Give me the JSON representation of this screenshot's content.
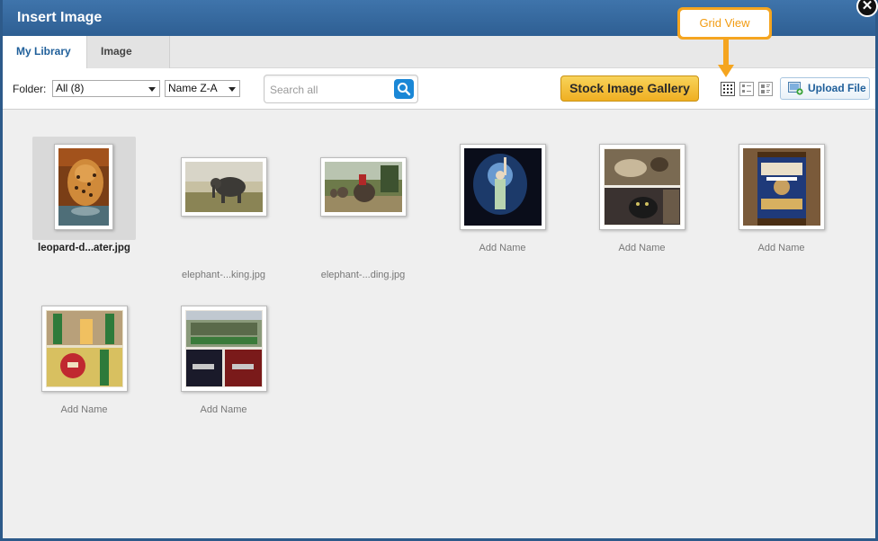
{
  "dialog": {
    "title": "Insert Image",
    "close_symbol": "✕"
  },
  "tabs": [
    {
      "label": "My Library",
      "active": true
    },
    {
      "label": "Image URL",
      "active": false
    }
  ],
  "toolbar": {
    "folder_label": "Folder:",
    "folder_value": "All (8)",
    "sort_value": "Name Z-A",
    "search_placeholder": "Search all",
    "stock_button": "Stock Image Gallery",
    "upload_button": "Upload File",
    "view_modes": [
      "grid-view-icon",
      "list-view-icon",
      "detail-view-icon"
    ],
    "accent_color": "#f0b12a"
  },
  "callout": {
    "text": "Grid View",
    "color": "#f5a51f"
  },
  "images": [
    {
      "name": "leopard-d...ater.jpg",
      "selected": true,
      "orientation": "portrait"
    },
    {
      "name": "elephant-...king.jpg",
      "selected": false,
      "orientation": "landscape"
    },
    {
      "name": "elephant-...ding.jpg",
      "selected": false,
      "orientation": "landscape"
    },
    {
      "name": "Add Name",
      "selected": false,
      "orientation": "square"
    },
    {
      "name": "Add Name",
      "selected": false,
      "orientation": "square"
    },
    {
      "name": "Add Name",
      "selected": false,
      "orientation": "square"
    },
    {
      "name": "Add Name",
      "selected": false,
      "orientation": "square"
    },
    {
      "name": "Add Name",
      "selected": false,
      "orientation": "square"
    }
  ]
}
